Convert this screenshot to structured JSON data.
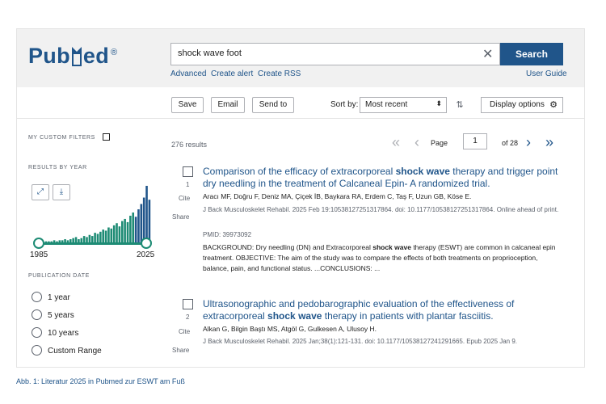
{
  "header": {
    "logo_text_pub": "Pub",
    "logo_text_med": "ed",
    "logo_reg": "®",
    "search_value": "shock wave foot",
    "search_button": "Search",
    "links": [
      "Advanced",
      "Create alert",
      "Create RSS"
    ],
    "user_guide": "User Guide"
  },
  "toolbar": {
    "save": "Save",
    "email": "Email",
    "send_to": "Send to",
    "sort_by_label": "Sort by:",
    "sort_value": "Most recent",
    "display_options": "Display options"
  },
  "sidebar": {
    "custom_filters": "MY CUSTOM FILTERS",
    "results_by_year": "RESULTS BY YEAR",
    "year_start": "1985",
    "year_end": "2025",
    "publication_date": "PUBLICATION DATE",
    "date_options": [
      "1 year",
      "5 years",
      "10 years",
      "Custom Range"
    ],
    "histogram_counts": [
      1,
      0,
      1,
      1,
      1,
      2,
      1,
      2,
      2,
      3,
      2,
      3,
      4,
      5,
      3,
      4,
      6,
      5,
      7,
      6,
      9,
      8,
      10,
      12,
      11,
      14,
      13,
      16,
      18,
      15,
      20,
      22,
      19,
      25,
      28,
      24,
      31,
      36,
      42,
      53,
      40
    ]
  },
  "results": {
    "count": "276 results",
    "page_label": "Page",
    "page_value": "1",
    "page_of": "of 28",
    "articles": [
      {
        "num": "1",
        "title_pre": "Comparison of the efficacy of extracorporeal ",
        "title_bold": "shock wave",
        "title_post": " therapy and trigger point dry needling in the treatment of Calcaneal Epin- A randomized trial.",
        "authors": "Aracı MF, Doğru F, Deniz MA, Çiçek İB, Baykara RA, Erdem C, Taş F, Uzun GB, Köse E.",
        "journal": "J Back Musculoskelet Rehabil. 2025 Feb 19:10538127251317864. doi: 10.1177/10538127251317864. Online ahead of print.",
        "pmid": "PMID: 39973092",
        "snippet_pre": "BACKGROUND: Dry needling (DN) and Extracorporeal ",
        "snippet_bold": "shock wave",
        "snippet_post": " therapy (ESWT) are common in calcaneal epin treatment. OBJECTIVE: The aim of the study was to compare the effects of both treatments on proprioception, balance, pain, and functional status. ...CONCLUSIONS: ...",
        "cite": "Cite",
        "share": "Share"
      },
      {
        "num": "2",
        "title_pre": "Ultrasonographic and pedobarographic evaluation of the effectiveness of extracorporeal ",
        "title_bold": "shock wave",
        "title_post": " therapy in patients with plantar fasciitis.",
        "authors": "Alkan G, Bilgin Baştı MS, Atgöl G, Gulkesen A, Ulusoy H.",
        "journal": "J Back Musculoskelet Rehabil. 2025 Jan;38(1):121-131. doi: 10.1177/10538127241291665. Epub 2025 Jan 9.",
        "cite": "Cite",
        "share": "Share"
      }
    ]
  },
  "caption": "Abb. 1: Literatur 2025 in Pubmed zur ESWT am Fuß",
  "colors": {
    "brand": "#20558a",
    "histogram": "#1d8b74",
    "histogram_recent": "#20558a"
  }
}
